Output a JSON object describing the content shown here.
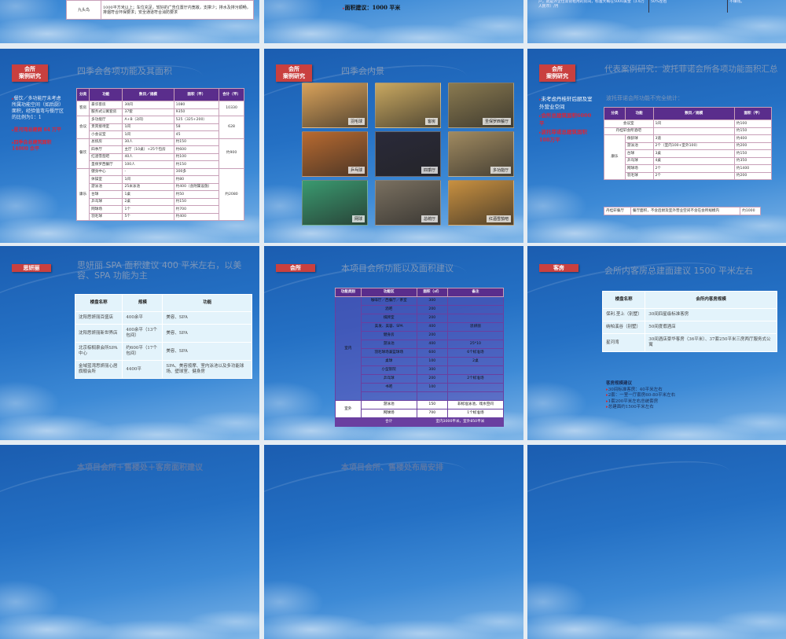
{
  "top_slides": {
    "s1": {
      "row_name": "九头鸟",
      "row_text": "1000平方米以上；车位充足，较好的广告位置厅内宽敞，支撑少；排水及排污顺畅，排烟符合环保要求；安全通道符合消防要求"
    },
    "s2": {
      "area_note": "面积建议：1000 平米"
    },
    "s3": {
      "col1": "住率达到70-80%，按季租在80%左右，另一个以上的长包房客户，就是外企位高管租用的房间，标准大概在5000美金（3.6万人民币）/月",
      "col2": "3万/天，会议/婚宴的收益会占到总收益的50%左右",
      "col3": "不赚钱。"
    }
  },
  "slide_a": {
    "tag": "会所\n案例研究",
    "title": "四季会各项功能及其面积",
    "notes": [
      "餐饮／多功能厅未考虑所属功能空间（如后厨）面积，经验值弯与餐厅区的比例为1：1",
      "星河湾总建面 64 万平",
      "四季会总建筑面积 14000 余平"
    ],
    "table": {
      "headers": [
        "分类",
        "功能",
        "数目／规模",
        "面积（平）",
        "合计（平）"
      ],
      "rows": [
        [
          {
            "t": "客房",
            "rowspan": 2
          },
          "豪华客房",
          "30间",
          "1080",
          {
            "t": "10330",
            "rowspan": 2
          }
        ],
        [
          "服务式公寓套房",
          "37套",
          "9350"
        ],
        [
          {
            "t": "会议",
            "rowspan": 3
          },
          "多功能厅",
          "A+B（2间）",
          "525（325+200）",
          {
            "t": "628",
            "rowspan": 3
          }
        ],
        [
          "贵宾接待室",
          "1间",
          "58"
        ],
        [
          "小会议室",
          "1间",
          "45"
        ],
        [
          {
            "t": "餐饮",
            "rowspan": 4
          },
          "总统房",
          "30人",
          "约150",
          {
            "t": "约900",
            "rowspan": 4
          }
        ],
        [
          "四季厅",
          "主厅（10桌）+25个包房",
          "约600"
        ],
        [
          "红酒雪茄吧",
          "40人",
          "约100"
        ],
        [
          "圣保罗西餐厅",
          "100人",
          "约150"
        ],
        [
          {
            "t": "康乐",
            "rowspan": 8
          },
          "健身中心",
          "-",
          "300多",
          {
            "t": "约2080",
            "rowspan": 8
          }
        ],
        [
          "体操室",
          "1间",
          "约80"
        ],
        [
          "游泳池",
          "25米泳池",
          "约400（含附属设施）"
        ],
        [
          "台球",
          "1桌",
          "约50"
        ],
        [
          "乒乓球",
          "2桌",
          "约150"
        ],
        [
          "网球场",
          "1个",
          "约700"
        ],
        [
          "羽毛球",
          "5个",
          "约400"
        ]
      ]
    }
  },
  "slide_b": {
    "tag": "会所\n案例研究",
    "title": "四季会内景",
    "photos": [
      {
        "caption": "羽毛球",
        "color": "#d9a25a"
      },
      {
        "caption": "客房",
        "color": "#c9a860"
      },
      {
        "caption": "圣保罗西餐厅",
        "color": "#8a7a50"
      },
      {
        "caption": "乒乓球",
        "color": "#b86a30"
      },
      {
        "caption": "四季厅",
        "color": "#2a2a3a"
      },
      {
        "caption": "多功能厅",
        "color": "#a08a60"
      },
      {
        "caption": "网球",
        "color": "#3a9a70"
      },
      {
        "caption": "总统厅",
        "color": "#7a7060"
      },
      {
        "caption": "红酒雪茄吧",
        "color": "#c89040"
      }
    ]
  },
  "slide_c": {
    "tag": "会所\n案例研究",
    "title": "代表案例研究：波托菲诺会所各项功能面积汇总",
    "subtitle": "波托菲诺会所功能不完全统计：",
    "notes": [
      "未考虑丹桂轩后厨及室外营业空间",
      "会所总建筑面积6000平",
      "波托菲诺总建筑面积108万平"
    ],
    "table": {
      "headers": [
        "分类",
        "功能",
        "数目／规模",
        "面积（平）"
      ],
      "rows": [
        [
          {
            "t": "会议室",
            "colspan": 2
          },
          "1间",
          "约100"
        ],
        [
          {
            "t": "丹桂轩会所酒吧",
            "colspan": 2
          },
          "",
          "约150"
        ],
        [
          {
            "t": "康乐",
            "rowspan": 6
          },
          "保龄球",
          "3道",
          "约400"
        ],
        [
          "游泳池",
          "2个（室内100+室外100）",
          "约200"
        ],
        [
          "台球",
          "3桌",
          "约150"
        ],
        [
          "乒乓球",
          "4桌",
          "约350"
        ],
        [
          "网球场",
          "2个",
          "约1400"
        ],
        [
          "羽毛球",
          "2个",
          "约200"
        ]
      ]
    },
    "table2": {
      "rows": [
        [
          "丹桂轩餐厅",
          "餐厅面积，不含后厨及室外营业空间不含在会所规模内",
          "约1000"
        ]
      ]
    }
  },
  "slide_d": {
    "tag": "思妍丽",
    "title": "思妍丽 SPA 面积建议 400 平米左右，以美容、SPA 功能为主",
    "table": {
      "headers": [
        "楼盘名称",
        "规模",
        "功能"
      ],
      "rows": [
        [
          "沈阳思妍丽百盛店",
          "400余平",
          "美容、SPA"
        ],
        [
          "沈阳思妍丽新世界店",
          "400余平（13个包间）",
          "美容、SPA"
        ],
        [
          "北京棕榈泉会所SPA中心",
          "约600平（17个包间）",
          "美容、SPA"
        ],
        [
          "金域蓝湾思妍丽心居旗舰会所",
          "4400平",
          "SPA、美容按摩、室内泳池以及多功能球场、壁球室、健身房"
        ]
      ]
    }
  },
  "slide_e": {
    "tag": "会所",
    "title": "本项目会所功能以及面积建议",
    "table": {
      "headers": [
        "功能类别",
        "功能区",
        "面积（㎡）",
        "备注"
      ],
      "rows": [
        [
          {
            "t": "室内",
            "rowspan": 12
          },
          "咖啡厅／西餐厅／茶室",
          "300",
          ""
        ],
        [
          "酒吧",
          "200",
          ""
        ],
        [
          "棋牌室",
          "200",
          ""
        ],
        [
          "美发、美容、SPA",
          "400",
          "思妍丽"
        ],
        [
          "健身房",
          "200",
          ""
        ],
        [
          "游泳池",
          "400",
          "25*10"
        ],
        [
          "羽毛球场兼篮球场",
          "600",
          "6个标准场"
        ],
        [
          "桌球",
          "100",
          "2桌"
        ],
        [
          "小型影院",
          "300",
          ""
        ],
        [
          "乒乓球",
          "200",
          "2个标准场"
        ],
        [
          "书吧",
          "100",
          ""
        ],
        [
          " ",
          " ",
          " "
        ],
        [
          {
            "t": "室外",
            "rowspan": 2,
            "out": true
          },
          {
            "t": "游泳池",
            "out": true
          },
          {
            "t": "150",
            "out": true
          },
          {
            "t": "非标准泳池，戏水空间",
            "out": true
          }
        ],
        [
          {
            "t": "网球场",
            "out": true
          },
          {
            "t": "700",
            "out": true
          },
          {
            "t": "1个标准场",
            "out": true
          }
        ],
        [
          {
            "t": "",
            "tot": true
          },
          {
            "t": "合计",
            "tot": true
          },
          {
            "t": "室内3000平米，室外850平米",
            "colspan": 2,
            "tot": true
          }
        ]
      ]
    }
  },
  "slide_f": {
    "tag": "客房",
    "title": "会所内客房总建面建议 1500 平米左右",
    "table": {
      "headers": [
        "楼盘名称",
        "会所内客房规模"
      ],
      "rows": [
        [
          "保利.垄上（别墅）",
          "30间四星级标准客房"
        ],
        [
          "纳帕溪谷（别墅）",
          "50间度假酒店"
        ],
        [
          "星河湾",
          "30间酒店豪华客房（36平米）、37套250平米三房两厅服务式公寓"
        ]
      ]
    },
    "suggest_title": "客房规模建议",
    "suggest": [
      "30间标准客房：40平米左右",
      "2套：一室一厅套房60-80平米左右",
      "1套200平米左右总统套房",
      "总建面约1500平米左右"
    ]
  },
  "bottom_slides": {
    "s1_title": "本项目会所＋售楼处＋客房面积建议",
    "s2_title": "本项目会所、售楼处布局安排"
  }
}
